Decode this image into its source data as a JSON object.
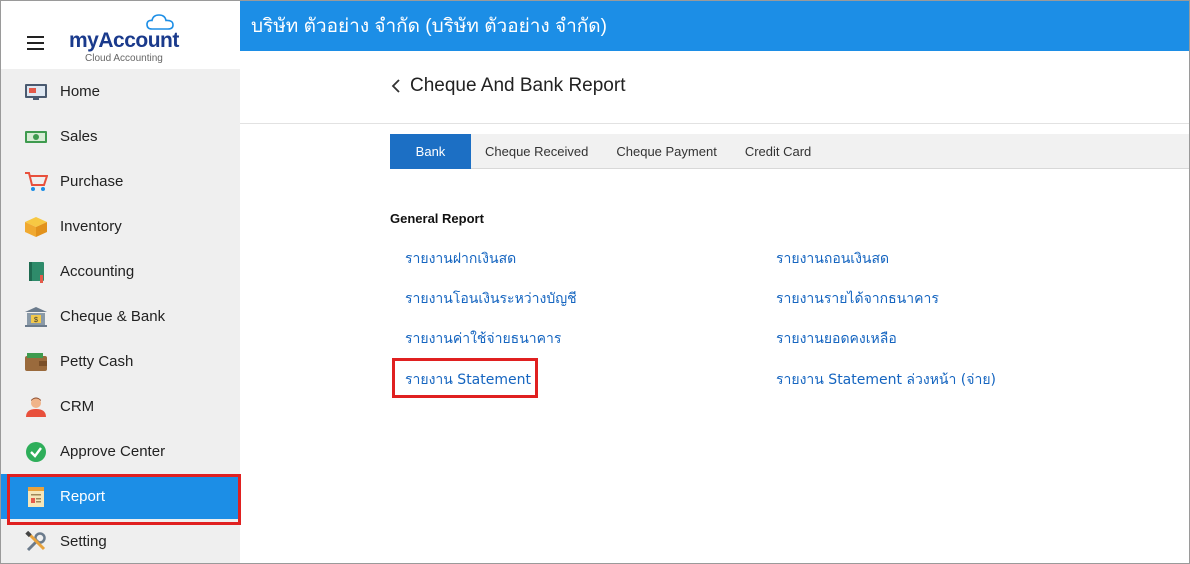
{
  "app": {
    "logo_text_my": "my",
    "logo_text_account": "Account",
    "logo_subtitle": "Cloud Accounting"
  },
  "company_name": "บริษัท ตัวอย่าง จำกัด (บริษัท ตัวอย่าง จำกัด)",
  "sidebar": {
    "items": [
      {
        "label": "Home",
        "icon": "monitor-icon"
      },
      {
        "label": "Sales",
        "icon": "cash-icon"
      },
      {
        "label": "Purchase",
        "icon": "cart-icon"
      },
      {
        "label": "Inventory",
        "icon": "box-icon"
      },
      {
        "label": "Accounting",
        "icon": "book-icon"
      },
      {
        "label": "Cheque & Bank",
        "icon": "bank-icon"
      },
      {
        "label": "Petty Cash",
        "icon": "wallet-icon"
      },
      {
        "label": "CRM",
        "icon": "person-icon"
      },
      {
        "label": "Approve Center",
        "icon": "check-circle-icon"
      },
      {
        "label": "Report",
        "icon": "report-icon",
        "active": true
      },
      {
        "label": "Setting",
        "icon": "wrench-icon"
      }
    ]
  },
  "page": {
    "title": "Cheque And Bank Report"
  },
  "tabs": [
    {
      "label": "Bank",
      "active": true
    },
    {
      "label": "Cheque Received"
    },
    {
      "label": "Cheque Payment"
    },
    {
      "label": "Credit Card"
    }
  ],
  "report": {
    "section_title": "General Report",
    "left_links": [
      "รายงานฝากเงินสด",
      "รายงานโอนเงินระหว่างบัญชี",
      "รายงานค่าใช้จ่ายธนาคาร",
      "รายงาน Statement"
    ],
    "right_links": [
      "รายงานถอนเงินสด",
      "รายงานรายได้จากธนาคาร",
      "รายงานยอดคงเหลือ",
      "รายงาน Statement ล่วงหน้า (จ่าย)"
    ]
  },
  "colors": {
    "accent": "#1c8ee6",
    "tab_active": "#1c6fc4",
    "link": "#1565c0",
    "highlight": "#e02020"
  }
}
